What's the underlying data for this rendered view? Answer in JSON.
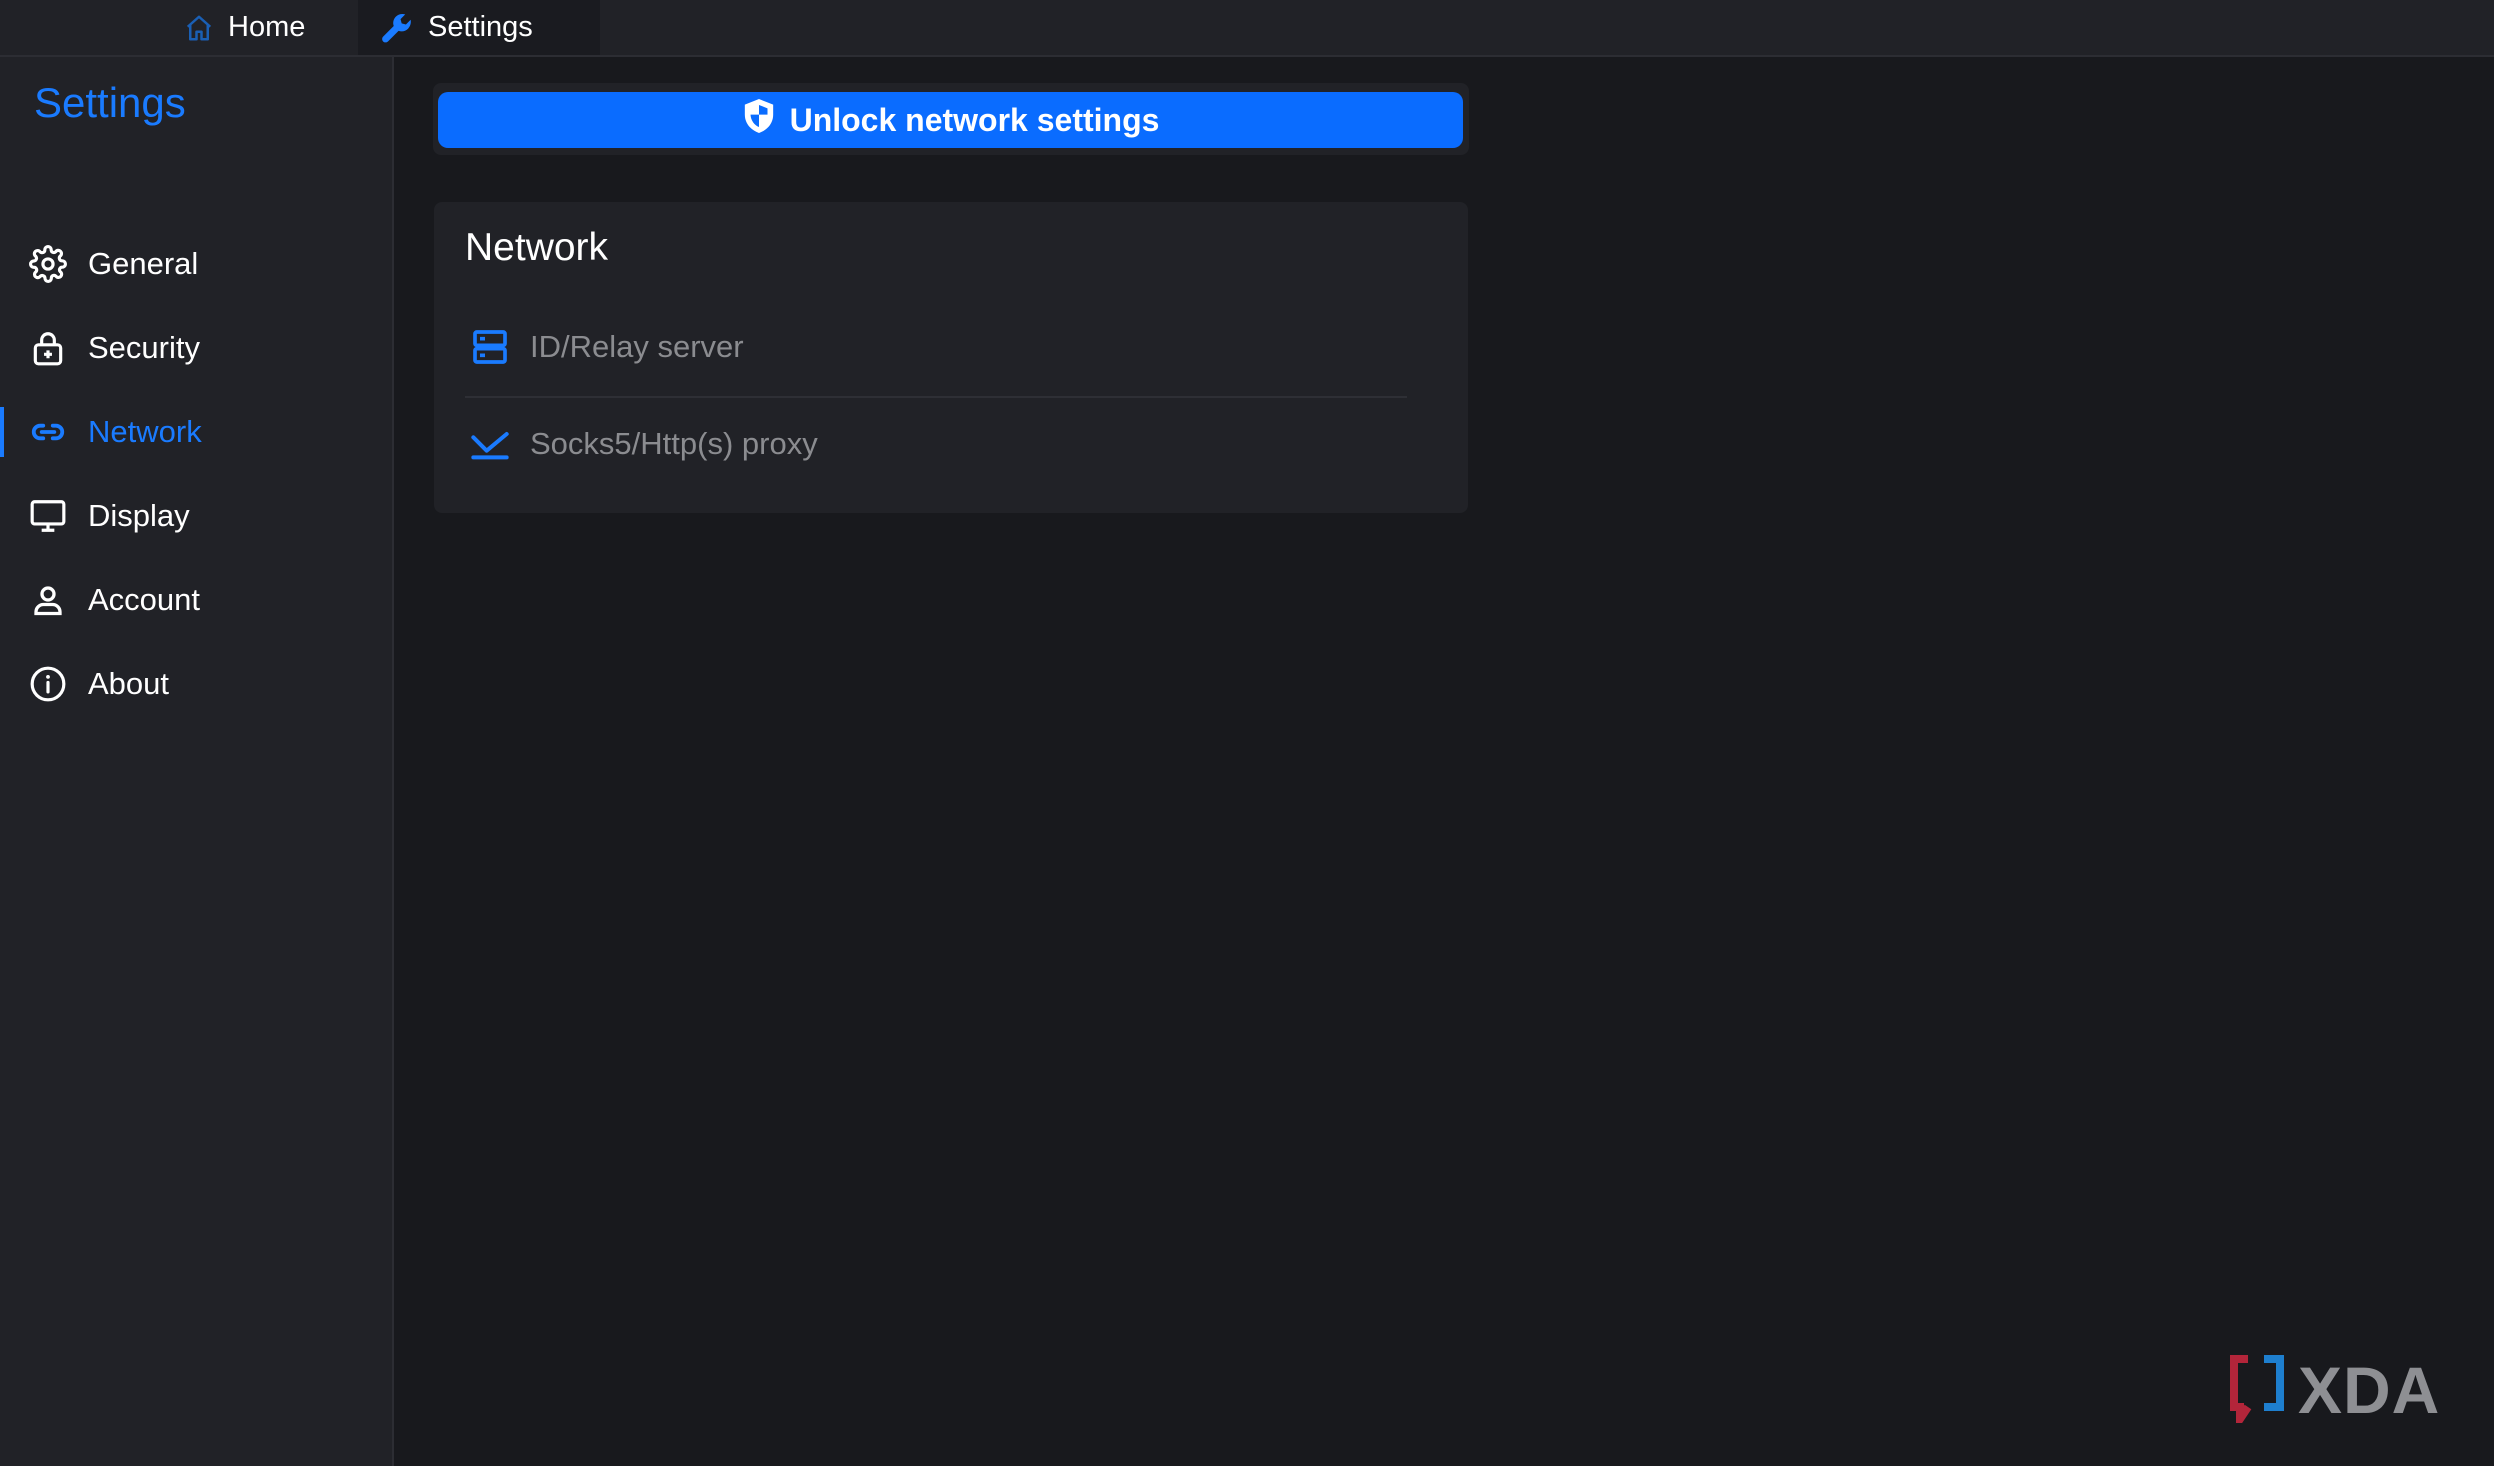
{
  "tabs": [
    {
      "label": "Home",
      "icon": "home-icon"
    },
    {
      "label": "Settings",
      "icon": "wrench-icon",
      "active": true
    }
  ],
  "sidebar": {
    "title": "Settings",
    "items": [
      {
        "label": "General",
        "icon": "gear-icon"
      },
      {
        "label": "Security",
        "icon": "lock-icon"
      },
      {
        "label": "Network",
        "icon": "link-icon",
        "active": true
      },
      {
        "label": "Display",
        "icon": "monitor-icon"
      },
      {
        "label": "Account",
        "icon": "user-icon"
      },
      {
        "label": "About",
        "icon": "info-icon"
      }
    ]
  },
  "main": {
    "unlock_label": "Unlock network settings",
    "card": {
      "title": "Network",
      "rows": [
        {
          "label": "ID/Relay server",
          "icon": "server-icon"
        },
        {
          "label": "Socks5/Http(s) proxy",
          "icon": "proxy-icon"
        }
      ]
    }
  },
  "watermark": {
    "text": "XDA"
  },
  "colors": {
    "accent": "#0a6cff",
    "link": "#1a7bff",
    "background": "#18191d",
    "panel": "#212227"
  }
}
